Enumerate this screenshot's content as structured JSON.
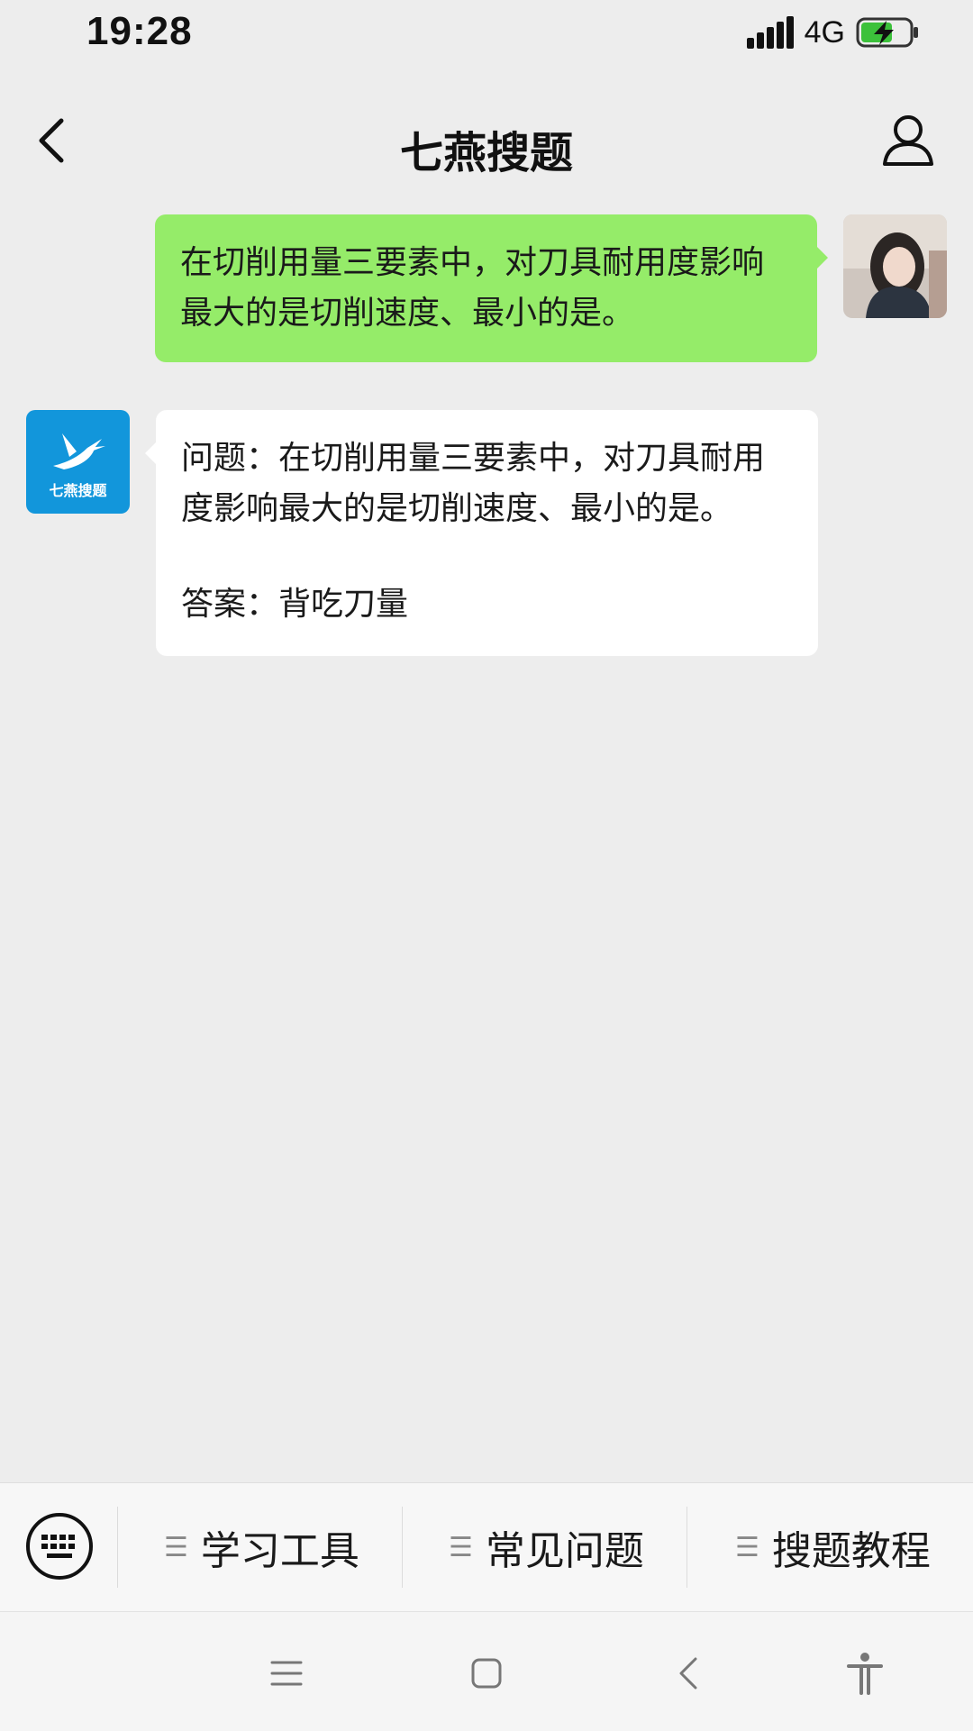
{
  "status": {
    "time": "19:28",
    "network": "4G",
    "icons": [
      "signal-icon",
      "battery-charging-icon"
    ]
  },
  "header": {
    "title": "七燕搜题",
    "back_icon": "chevron-left-icon",
    "profile_icon": "person-outline-icon"
  },
  "messages": [
    {
      "sender": "user",
      "text": "在切削用量三要素中，对刀具耐用度影响最大的是切削速度、最小的是。"
    },
    {
      "sender": "bot",
      "avatar_label": "七燕搜题",
      "question": "问题：在切削用量三要素中，对刀具耐用度影响最大的是切削速度、最小的是。",
      "answer": "答案：背吃刀量"
    }
  ],
  "menu": {
    "keyboard_icon": "keyboard-icon",
    "items": [
      {
        "label": "学习工具",
        "icon": "menu-lines-icon"
      },
      {
        "label": "常见问题",
        "icon": "menu-lines-icon"
      },
      {
        "label": "搜题教程",
        "icon": "menu-lines-icon"
      }
    ]
  },
  "nav": {
    "icons": [
      "menu-icon",
      "home-icon",
      "back-icon",
      "accessibility-icon"
    ]
  },
  "colors": {
    "background": "#ededed",
    "user_bubble": "#95ec69",
    "bot_bubble": "#ffffff",
    "brand_blue": "#1296db"
  }
}
